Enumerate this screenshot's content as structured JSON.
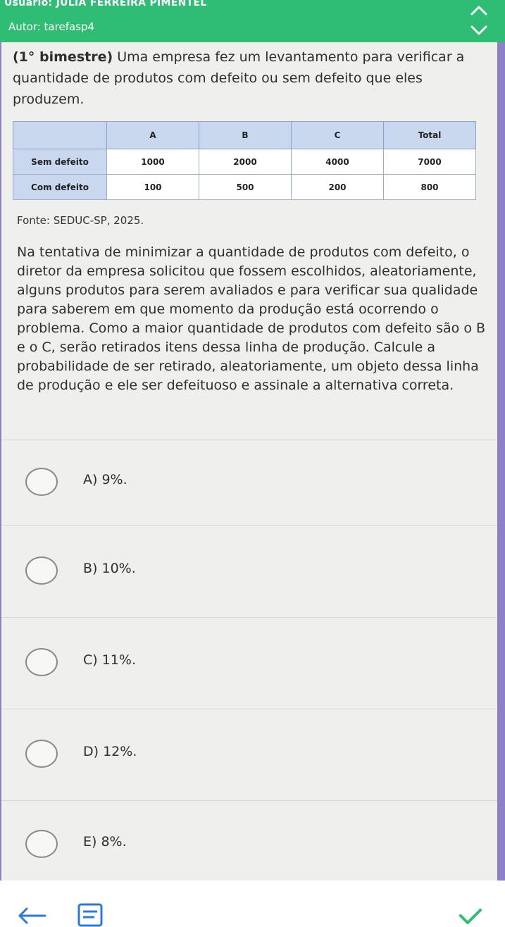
{
  "header": {
    "user_label": "Usuário: JULIA FERREIRA PIMENTEL",
    "author_label": "Autor: tarefasp4"
  },
  "question": {
    "prefix": "(1° bimestre)",
    "intro": " Uma empresa fez um levantamento para verificar a quantidade de produtos com defeito ou sem defeito que eles produzem.",
    "source": "Fonte: SEDUC-SP, 2025.",
    "body": "Na tentativa de minimizar a quantidade de produtos com defeito, o diretor da empresa solicitou que fossem escolhidos, aleatoriamente, alguns produtos para serem avaliados e para verificar sua qualidade para saberem em que momento da produção está ocorrendo o problema. Como a maior quantidade de produtos com defeito são o B e o C, serão retirados itens dessa linha de produção. Calcule a probabilidade de ser retirado, aleatoriamente, um objeto dessa linha de produção e ele ser defeituoso e assinale a alternativa correta."
  },
  "table": {
    "headers": [
      "",
      "A",
      "B",
      "C",
      "Total"
    ],
    "rows": [
      {
        "label": "Sem defeito",
        "values": [
          "1000",
          "2000",
          "4000",
          "7000"
        ]
      },
      {
        "label": "Com defeito",
        "values": [
          "100",
          "500",
          "200",
          "800"
        ]
      }
    ]
  },
  "options": [
    {
      "label": "A) 9%."
    },
    {
      "label": "B) 10%."
    },
    {
      "label": "C) 11%."
    },
    {
      "label": "D) 12%."
    },
    {
      "label": "E) 8%."
    }
  ],
  "colors": {
    "header_green": "#2ebd72",
    "background_purple": "#8e7fc6",
    "card": "#efefed",
    "table_header": "#c9d8ef",
    "check_green": "#2ebd72"
  },
  "icons": {
    "collapse": "chevron-up-down-icon",
    "back": "back-arrow-icon",
    "list": "list-icon",
    "check": "check-icon"
  }
}
